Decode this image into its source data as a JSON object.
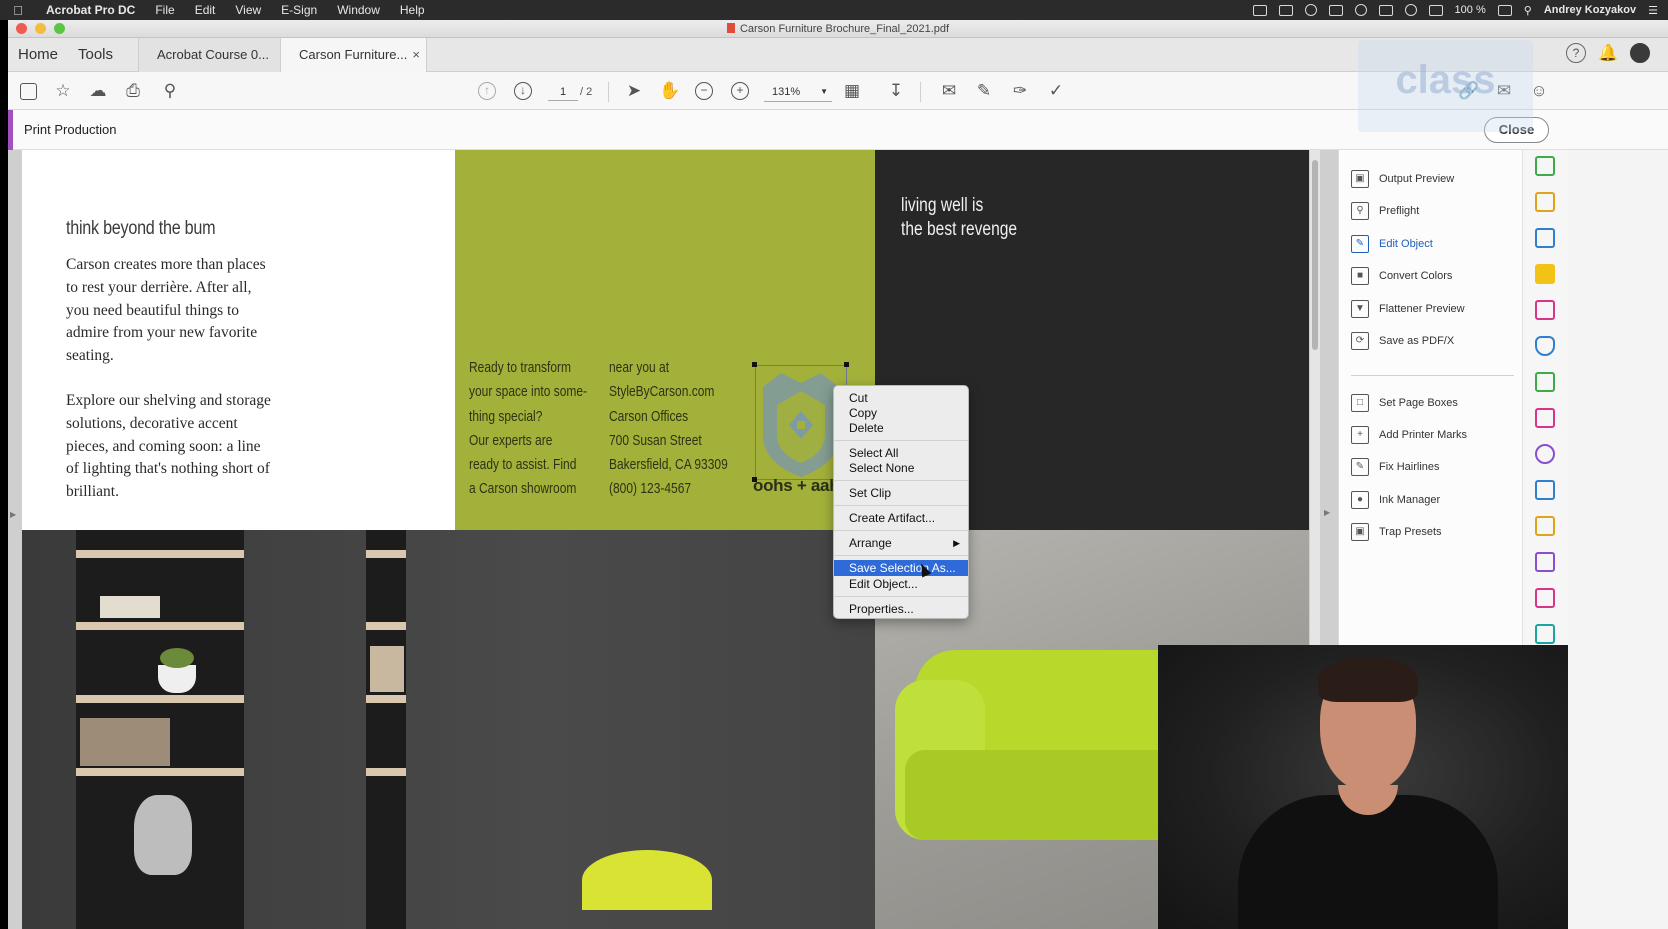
{
  "menubar": {
    "app_name": "Acrobat Pro DC",
    "menus": [
      "File",
      "Edit",
      "View",
      "E-Sign",
      "Window",
      "Help"
    ],
    "battery": "100 %",
    "user": "Andrey Kozyakov"
  },
  "window": {
    "title": "Carson Furniture Brochure_Final_2021.pdf"
  },
  "tabbar": {
    "home": "Home",
    "tools": "Tools",
    "tab_inactive": "Acrobat Course 0...",
    "tab_active": "Carson Furniture...",
    "tab_close": "×"
  },
  "toolbar": {
    "page_current": "1",
    "page_total": "/ 2",
    "zoom": "131%"
  },
  "prodbar": {
    "title": "Print Production",
    "close_label": "Close"
  },
  "watermark": {
    "text": "class"
  },
  "document": {
    "heading": "think beyond the bum",
    "para1": "Carson creates more than places to rest your derrière. After all, you need beautiful things to admire from your new favorite seating.",
    "para2": "Explore our shelving and storage solutions, decorative accent pieces, and coming soon: a line of lighting that's nothing short of brilliant.",
    "green_col1": [
      "Ready to transform",
      "your space into some-",
      "thing special?",
      "Our experts are",
      "ready to assist. Find",
      "a Carson showroom"
    ],
    "green_col2": [
      "near you at",
      "StyleByCarson.com",
      "Carson Offices",
      "700 Susan Street",
      "Bakersfield, CA 93309",
      "(800) 123-4567"
    ],
    "logo_text": "oohs + aah",
    "dark_text": [
      "living well is",
      "the best revenge"
    ]
  },
  "context_menu": {
    "items": [
      "Cut",
      "Copy",
      "Delete",
      "Select All",
      "Select None",
      "Set Clip",
      "Create Artifact...",
      "Arrange",
      "Save Selection As...",
      "Edit Object...",
      "Properties..."
    ],
    "highlighted": "Save Selection As..."
  },
  "tools_panel": {
    "items": [
      "Output Preview",
      "Preflight",
      "Edit Object",
      "Convert Colors",
      "Flattener Preview",
      "Save as PDF/X",
      "Set Page Boxes",
      "Add Printer Marks",
      "Fix Hairlines",
      "Ink Manager",
      "Trap Presets"
    ],
    "selected": "Edit Object"
  },
  "colors": {
    "accent_purple": "#a54ec0",
    "brochure_green": "#a3b13a",
    "brochure_dark": "#272727",
    "menu_highlight": "#2f6ad9",
    "selected_tool": "#1f5fb9"
  }
}
